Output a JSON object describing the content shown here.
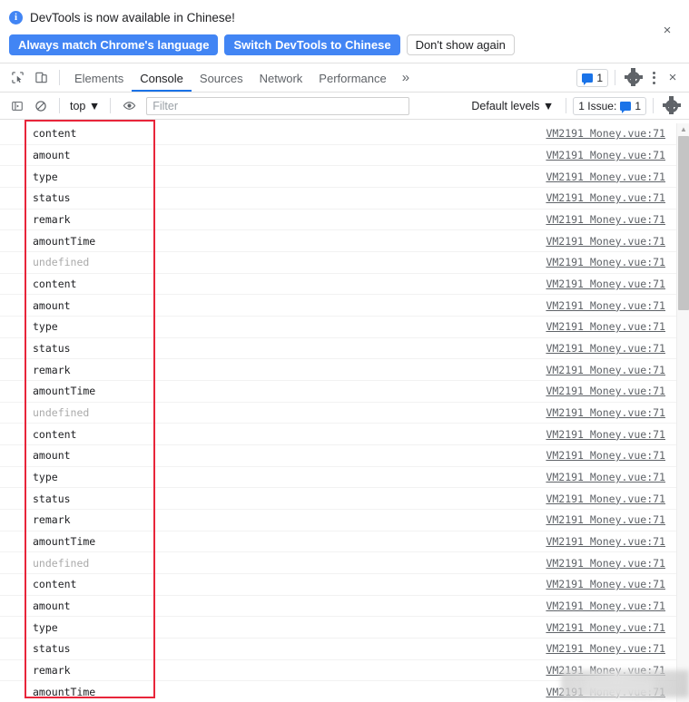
{
  "infobar": {
    "icon": "info-icon",
    "message": "DevTools is now available in Chinese!",
    "buttons": [
      {
        "label": "Always match Chrome's language",
        "style": "primary"
      },
      {
        "label": "Switch DevTools to Chinese",
        "style": "primary"
      },
      {
        "label": "Don't show again",
        "style": "secondary"
      }
    ],
    "close_label": "×"
  },
  "tabstrip": {
    "inspect_icon": "inspect-element-icon",
    "device_icon": "device-toolbar-icon",
    "tabs": [
      {
        "label": "Elements",
        "active": false
      },
      {
        "label": "Console",
        "active": true
      },
      {
        "label": "Sources",
        "active": false
      },
      {
        "label": "Network",
        "active": false
      },
      {
        "label": "Performance",
        "active": false
      }
    ],
    "more_tabs_label": "»",
    "issue_count": "1",
    "settings_icon": "gear-icon",
    "menu_icon": "kebab-menu-icon",
    "close_label": "×"
  },
  "consolebar": {
    "sidebar_icon": "console-sidebar-icon",
    "clear_icon": "clear-console-icon",
    "context": "top ▼",
    "eye_icon": "live-expression-icon",
    "filter_placeholder": "Filter",
    "filter_value": "",
    "levels": "Default levels ▼",
    "issues_label": "1 Issue:",
    "issues_count": "1",
    "settings_icon": "console-settings-gear-icon"
  },
  "console": {
    "source_link": "VM2191 Money.vue:71",
    "rows": [
      {
        "text": "content",
        "kind": "log"
      },
      {
        "text": "amount",
        "kind": "log"
      },
      {
        "text": "type",
        "kind": "log"
      },
      {
        "text": "status",
        "kind": "log"
      },
      {
        "text": "remark",
        "kind": "log"
      },
      {
        "text": "amountTime",
        "kind": "log"
      },
      {
        "text": "undefined",
        "kind": "undefined"
      },
      {
        "text": "content",
        "kind": "log"
      },
      {
        "text": "amount",
        "kind": "log"
      },
      {
        "text": "type",
        "kind": "log"
      },
      {
        "text": "status",
        "kind": "log"
      },
      {
        "text": "remark",
        "kind": "log"
      },
      {
        "text": "amountTime",
        "kind": "log"
      },
      {
        "text": "undefined",
        "kind": "undefined"
      },
      {
        "text": "content",
        "kind": "log"
      },
      {
        "text": "amount",
        "kind": "log"
      },
      {
        "text": "type",
        "kind": "log"
      },
      {
        "text": "status",
        "kind": "log"
      },
      {
        "text": "remark",
        "kind": "log"
      },
      {
        "text": "amountTime",
        "kind": "log"
      },
      {
        "text": "undefined",
        "kind": "undefined"
      },
      {
        "text": "content",
        "kind": "log"
      },
      {
        "text": "amount",
        "kind": "log"
      },
      {
        "text": "type",
        "kind": "log"
      },
      {
        "text": "status",
        "kind": "log"
      },
      {
        "text": "remark",
        "kind": "log"
      },
      {
        "text": "amountTime",
        "kind": "log"
      }
    ],
    "scroll_up_arrow": "▲"
  },
  "colors": {
    "accent_blue": "#4285f4",
    "tab_underline": "#1a73e8",
    "annotation_red": "#e8253a",
    "undefined_grey": "#aaaaaa"
  }
}
